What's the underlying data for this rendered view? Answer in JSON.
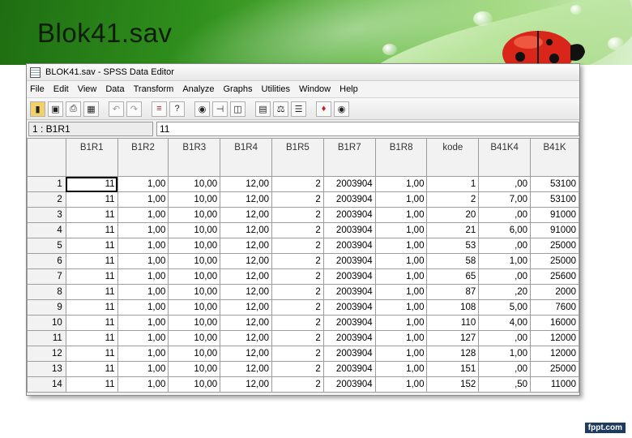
{
  "slide": {
    "title": "Blok41.sav",
    "footer_logo": "fppt.com"
  },
  "window": {
    "title": "BLOK41.sav - SPSS Data Editor",
    "menu": [
      "File",
      "Edit",
      "View",
      "Data",
      "Transform",
      "Analyze",
      "Graphs",
      "Utilities",
      "Window",
      "Help"
    ],
    "toolbar_icons": [
      "open-icon",
      "save-icon",
      "print-icon",
      "dialog-recall-icon",
      "undo-icon",
      "redo-icon",
      "goto-case-icon",
      "variables-icon",
      "find-icon",
      "insert-case-icon",
      "insert-variable-icon",
      "split-file-icon",
      "weight-cases-icon",
      "select-cases-icon",
      "value-labels-icon",
      "use-sets-icon"
    ]
  },
  "cell_editor": {
    "reference": "1 : B1R1",
    "value": "11"
  },
  "grid": {
    "columns": [
      "B1R1",
      "B1R2",
      "B1R3",
      "B1R4",
      "B1R5",
      "B1R7",
      "B1R8",
      "kode",
      "B41K4",
      "B41K"
    ],
    "rows": [
      {
        "n": "1",
        "cells": [
          "11",
          "1,00",
          "10,00",
          "12,00",
          "2",
          "2003904",
          "1,00",
          "1",
          ",00",
          "53100"
        ]
      },
      {
        "n": "2",
        "cells": [
          "11",
          "1,00",
          "10,00",
          "12,00",
          "2",
          "2003904",
          "1,00",
          "2",
          "7,00",
          "53100"
        ]
      },
      {
        "n": "3",
        "cells": [
          "11",
          "1,00",
          "10,00",
          "12,00",
          "2",
          "2003904",
          "1,00",
          "20",
          ",00",
          "91000"
        ]
      },
      {
        "n": "4",
        "cells": [
          "11",
          "1,00",
          "10,00",
          "12,00",
          "2",
          "2003904",
          "1,00",
          "21",
          "6,00",
          "91000"
        ]
      },
      {
        "n": "5",
        "cells": [
          "11",
          "1,00",
          "10,00",
          "12,00",
          "2",
          "2003904",
          "1,00",
          "53",
          ",00",
          "25000"
        ]
      },
      {
        "n": "6",
        "cells": [
          "11",
          "1,00",
          "10,00",
          "12,00",
          "2",
          "2003904",
          "1,00",
          "58",
          "1,00",
          "25000"
        ]
      },
      {
        "n": "7",
        "cells": [
          "11",
          "1,00",
          "10,00",
          "12,00",
          "2",
          "2003904",
          "1,00",
          "65",
          ",00",
          "25600"
        ]
      },
      {
        "n": "8",
        "cells": [
          "11",
          "1,00",
          "10,00",
          "12,00",
          "2",
          "2003904",
          "1,00",
          "87",
          ",20",
          "2000"
        ]
      },
      {
        "n": "9",
        "cells": [
          "11",
          "1,00",
          "10,00",
          "12,00",
          "2",
          "2003904",
          "1,00",
          "108",
          "5,00",
          "7600"
        ]
      },
      {
        "n": "10",
        "cells": [
          "11",
          "1,00",
          "10,00",
          "12,00",
          "2",
          "2003904",
          "1,00",
          "110",
          "4,00",
          "16000"
        ]
      },
      {
        "n": "11",
        "cells": [
          "11",
          "1,00",
          "10,00",
          "12,00",
          "2",
          "2003904",
          "1,00",
          "127",
          ",00",
          "12000"
        ]
      },
      {
        "n": "12",
        "cells": [
          "11",
          "1,00",
          "10,00",
          "12,00",
          "2",
          "2003904",
          "1,00",
          "128",
          "1,00",
          "12000"
        ]
      },
      {
        "n": "13",
        "cells": [
          "11",
          "1,00",
          "10,00",
          "12,00",
          "2",
          "2003904",
          "1,00",
          "151",
          ",00",
          "25000"
        ]
      },
      {
        "n": "14",
        "cells": [
          "11",
          "1,00",
          "10,00",
          "12,00",
          "2",
          "2003904",
          "1,00",
          "152",
          ",50",
          "11000"
        ]
      }
    ]
  },
  "colors": {
    "header_green": "#2f8f1c",
    "ladybug_red": "#d8261a"
  }
}
